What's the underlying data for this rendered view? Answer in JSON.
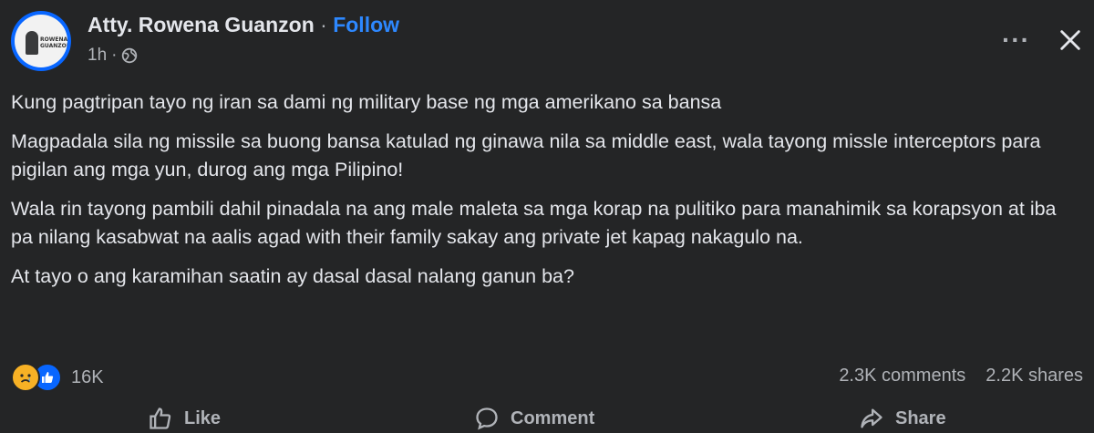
{
  "post": {
    "author": "Atty. Rowena Guanzon",
    "separator": " · ",
    "follow_label": "Follow",
    "time": "1h",
    "time_separator": "·",
    "privacy_icon": "globe-icon",
    "paragraphs": [
      "Kung pagtripan tayo ng iran sa dami ng military base ng mga amerikano sa bansa",
      "Magpadala sila ng missile sa buong bansa katulad ng ginawa nila sa middle east, wala tayong missle interceptors para pigilan ang mga yun, durog ang mga Pilipino!",
      "Wala rin tayong pambili dahil pinadala na ang male maleta sa mga korap na pulitiko para manahimik sa korapsyon at iba pa nilang kasabwat na aalis agad with their family sakay ang private jet kapag nakagulo na.",
      "At tayo o ang karamihan saatin ay dasal dasal nalang ganun ba?"
    ]
  },
  "stats": {
    "reactions_count": "16K",
    "reaction_icons": [
      "sad-face-icon",
      "like-thumb-icon"
    ],
    "comments": "2.3K comments",
    "shares": "2.2K shares"
  },
  "actions": {
    "like_label": "Like",
    "comment_label": "Comment",
    "share_label": "Share"
  },
  "colors": {
    "background": "#242526",
    "text": "#e4e6eb",
    "secondary": "#b0b3b8",
    "follow": "#2d88ff",
    "like_blue": "#0866ff",
    "sad_yellow": "#f7b125"
  }
}
